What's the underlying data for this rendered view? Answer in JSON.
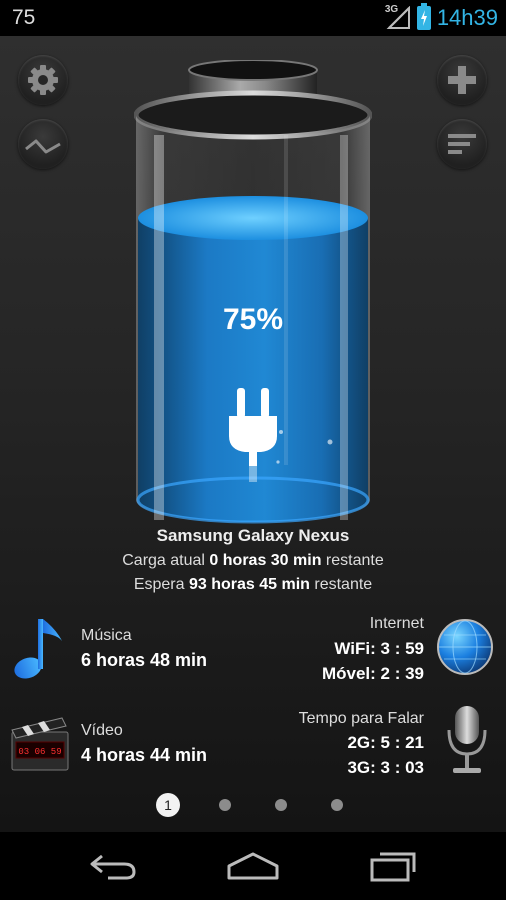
{
  "status_bar": {
    "battery_level_text": "75",
    "network_type": "3G",
    "time": "14h39",
    "battery_charging": true
  },
  "toolbar": {
    "settings": "gear-icon",
    "history": "line-chart-icon",
    "add": "plus-icon",
    "menu": "list-icon"
  },
  "battery": {
    "percent_text": "75%",
    "fill_level": 0.75,
    "accent_color": "#2e9fe8",
    "icon": "plug-icon"
  },
  "device": {
    "name": "Samsung Galaxy Nexus",
    "charge_label": "Carga atual",
    "charge_value": "0 horas 30 min",
    "charge_suffix": "restante",
    "standby_label": "Espera",
    "standby_value": "93 horas 45 min",
    "standby_suffix": "restante"
  },
  "usage": {
    "music": {
      "label": "Música",
      "value": "6 horas 48 min",
      "icon": "music-note-icon"
    },
    "video": {
      "label": "Vídeo",
      "value": "4 horas 44 min",
      "icon": "clapperboard-icon",
      "clock_text": "03 06 59"
    },
    "internet": {
      "label": "Internet",
      "wifi": "WiFi: 3 : 59",
      "mobile": "Móvel: 2 : 39",
      "icon": "globe-icon"
    },
    "talk": {
      "label": "Tempo para Falar",
      "g2": "2G: 5 : 21",
      "g3": "3G: 3 : 03",
      "icon": "microphone-icon"
    }
  },
  "pager": {
    "current": "1",
    "total": 4
  },
  "nav": {
    "back": "back-icon",
    "home": "home-icon",
    "recents": "recents-icon"
  }
}
